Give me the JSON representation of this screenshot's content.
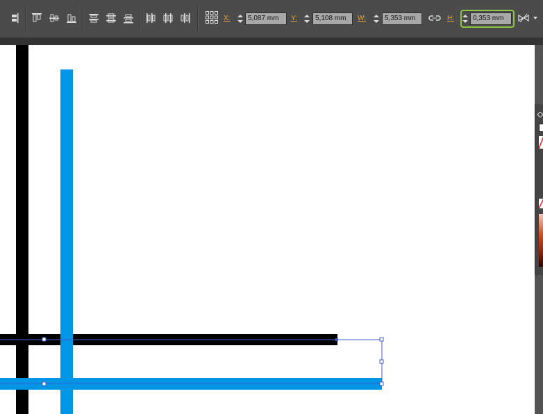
{
  "toolbar": {
    "x_label": "X:",
    "x_value": "5,087 mm",
    "y_label": "Y:",
    "y_value": "5,108 mm",
    "w_label": "W:",
    "w_value": "5,353 mm",
    "h_label": "H:",
    "h_value": "0,353 mm"
  },
  "colors": {
    "toolbar_bg": "#4b4b4b",
    "canvas_bg": "#ffffff",
    "black_line": "#000000",
    "blue_line": "#0096e6",
    "selection": "#3f5fd0",
    "field_highlight": "#8dc63f",
    "label_orange": "#e8a33a"
  }
}
